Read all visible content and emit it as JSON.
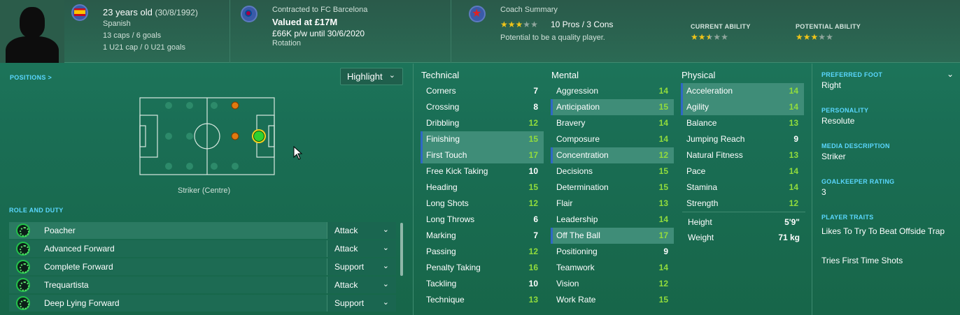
{
  "header": {
    "age_line": "23 years old",
    "dob": "(30/8/1992)",
    "nationality": "Spanish",
    "caps": "13 caps / 6 goals",
    "u21_caps": "1 U21 cap / 0 U21 goals",
    "contract_line": "Contracted to FC Barcelona",
    "value": "Valued at £17M",
    "wage": "£66K p/w until 30/6/2020",
    "squad_status": "Rotation",
    "coach_summary_title": "Coach Summary",
    "coach_stars": 3,
    "pros_cons": "10 Pros / 3 Cons",
    "potential_note": "Potential to be a quality player.",
    "current_ability_label": "CURRENT ABILITY",
    "current_ability_stars": 2.5,
    "potential_ability_label": "POTENTIAL ABILITY",
    "potential_ability_stars": 3
  },
  "positions": {
    "label": "POSITIONS >",
    "highlight_button": "Highlight",
    "caption": "Striker (Centre)"
  },
  "roles": {
    "label": "ROLE AND DUTY",
    "items": [
      {
        "name": "Poacher",
        "duty": "Attack"
      },
      {
        "name": "Advanced Forward",
        "duty": "Attack"
      },
      {
        "name": "Complete Forward",
        "duty": "Support"
      },
      {
        "name": "Trequartista",
        "duty": "Attack"
      },
      {
        "name": "Deep Lying Forward",
        "duty": "Support"
      }
    ]
  },
  "attributes": {
    "technical_head": "Technical",
    "mental_head": "Mental",
    "physical_head": "Physical",
    "technical": [
      {
        "name": "Corners",
        "value": "7"
      },
      {
        "name": "Crossing",
        "value": "8"
      },
      {
        "name": "Dribbling",
        "value": "12"
      },
      {
        "name": "Finishing",
        "value": "15"
      },
      {
        "name": "First Touch",
        "value": "17"
      },
      {
        "name": "Free Kick Taking",
        "value": "10"
      },
      {
        "name": "Heading",
        "value": "15"
      },
      {
        "name": "Long Shots",
        "value": "12"
      },
      {
        "name": "Long Throws",
        "value": "6"
      },
      {
        "name": "Marking",
        "value": "7"
      },
      {
        "name": "Passing",
        "value": "12"
      },
      {
        "name": "Penalty Taking",
        "value": "16"
      },
      {
        "name": "Tackling",
        "value": "10"
      },
      {
        "name": "Technique",
        "value": "13"
      }
    ],
    "mental": [
      {
        "name": "Aggression",
        "value": "14"
      },
      {
        "name": "Anticipation",
        "value": "15"
      },
      {
        "name": "Bravery",
        "value": "14"
      },
      {
        "name": "Composure",
        "value": "14"
      },
      {
        "name": "Concentration",
        "value": "12"
      },
      {
        "name": "Decisions",
        "value": "15"
      },
      {
        "name": "Determination",
        "value": "15"
      },
      {
        "name": "Flair",
        "value": "13"
      },
      {
        "name": "Leadership",
        "value": "14"
      },
      {
        "name": "Off The Ball",
        "value": "17"
      },
      {
        "name": "Positioning",
        "value": "9"
      },
      {
        "name": "Teamwork",
        "value": "14"
      },
      {
        "name": "Vision",
        "value": "12"
      },
      {
        "name": "Work Rate",
        "value": "15"
      }
    ],
    "physical": [
      {
        "name": "Acceleration",
        "value": "14"
      },
      {
        "name": "Agility",
        "value": "14"
      },
      {
        "name": "Balance",
        "value": "13"
      },
      {
        "name": "Jumping Reach",
        "value": "9"
      },
      {
        "name": "Natural Fitness",
        "value": "13"
      },
      {
        "name": "Pace",
        "value": "14"
      },
      {
        "name": "Stamina",
        "value": "14"
      },
      {
        "name": "Strength",
        "value": "12"
      }
    ],
    "height_label": "Height",
    "height": "5'9\"",
    "weight_label": "Weight",
    "weight": "71 kg"
  },
  "info": {
    "preferred_foot_label": "PREFERRED FOOT",
    "preferred_foot": "Right",
    "personality_label": "PERSONALITY",
    "personality": "Resolute",
    "media_label": "MEDIA DESCRIPTION",
    "media": "Striker",
    "gk_label": "GOALKEEPER RATING",
    "gk": "3",
    "traits_label": "PLAYER TRAITS",
    "traits": [
      "Likes To Try To Beat Offside Trap",
      "Tries First Time Shots"
    ]
  },
  "colors": {
    "accent_label": "#5ad7ff",
    "good_value": "#92dc3c",
    "highlight_row": "#3f8d78",
    "star_on": "#f0c419"
  }
}
